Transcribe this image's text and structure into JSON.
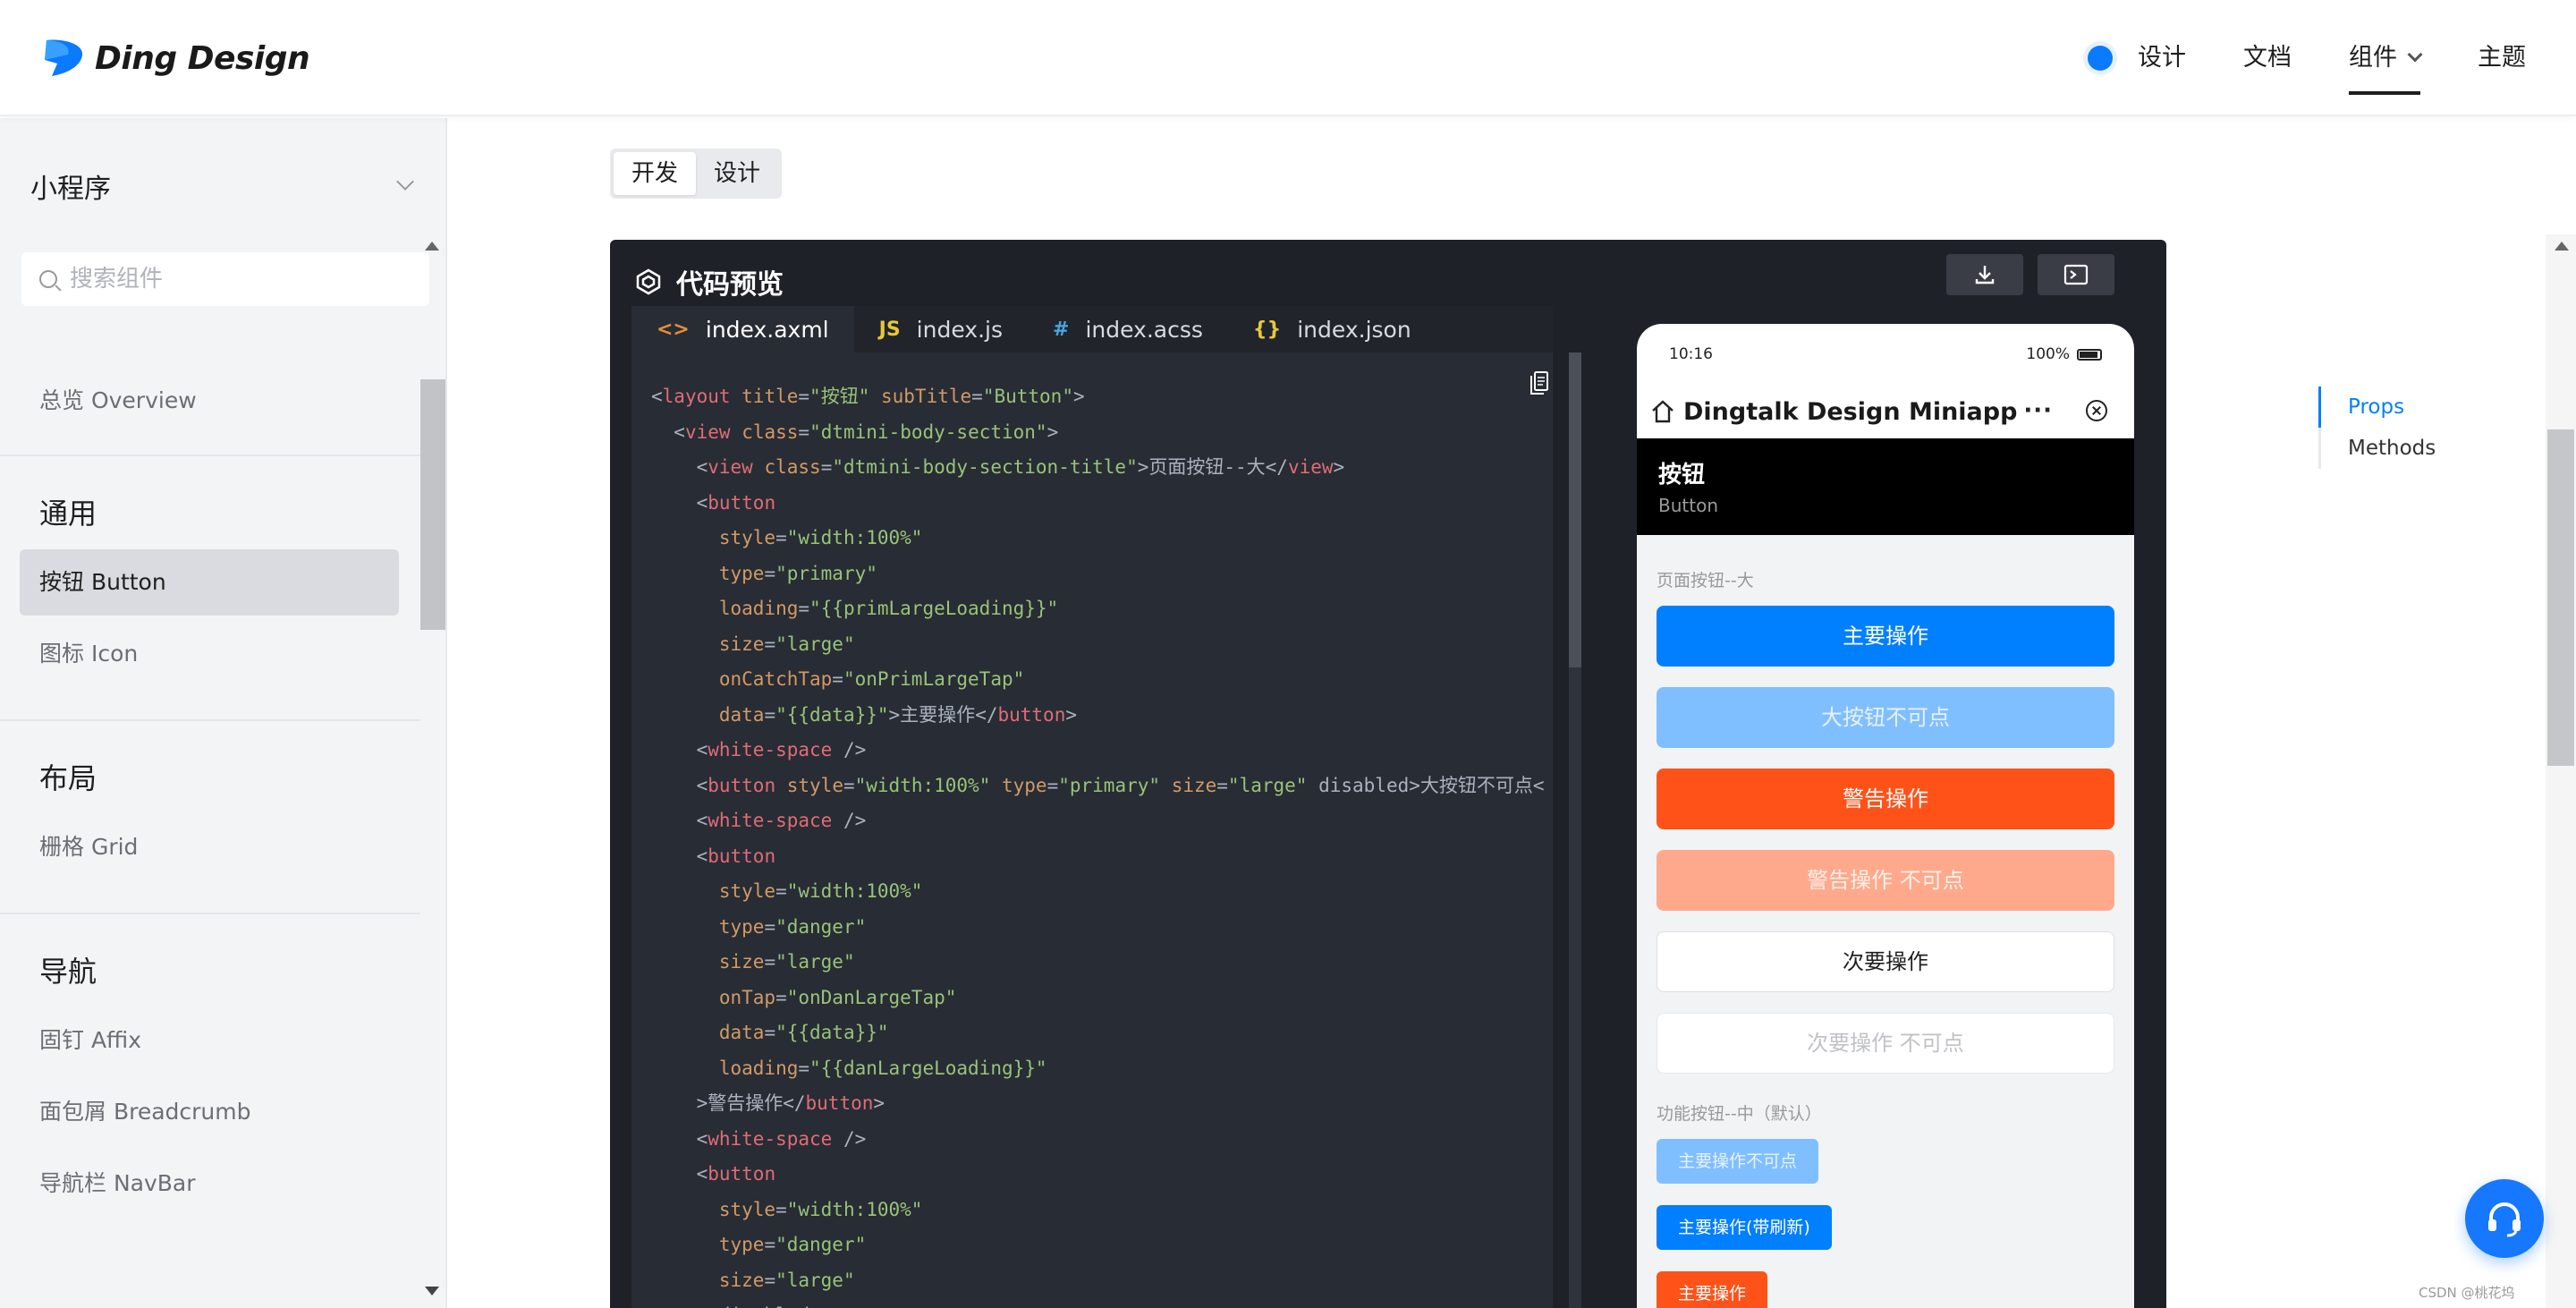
{
  "header": {
    "logo_text": "Ding Design",
    "nav": [
      "设计",
      "文档",
      "组件",
      "主题"
    ]
  },
  "sidebar": {
    "title": "小程序",
    "search_placeholder": "搜索组件",
    "overview": "总览 Overview",
    "groups": [
      {
        "title": "通用",
        "items": [
          "按钮 Button",
          "图标 Icon"
        ]
      },
      {
        "title": "布局",
        "items": [
          "栅格 Grid"
        ]
      },
      {
        "title": "导航",
        "items": [
          "固钉 Affix",
          "面包屑 Breadcrumb",
          "导航栏 NavBar"
        ]
      }
    ]
  },
  "segmented": {
    "dev": "开发",
    "design": "设计"
  },
  "panel": {
    "title": "代码预览",
    "tabs": [
      {
        "icon": "<>",
        "label": "index.axml"
      },
      {
        "icon": "JS",
        "label": "index.js"
      },
      {
        "icon": "#",
        "label": "index.acss"
      },
      {
        "icon": "{}",
        "label": "index.json"
      }
    ]
  },
  "phone": {
    "time": "10:16",
    "battery": "100%",
    "app_title": "Dingtalk Design Miniapp",
    "page_title": "按钮",
    "page_subtitle": "Button",
    "section1_label": "页面按钮--大",
    "large_buttons": [
      "主要操作",
      "大按钮不可点",
      "警告操作",
      "警告操作 不可点",
      "次要操作",
      "次要操作 不可点"
    ],
    "section2_label": "功能按钮--中（默认）",
    "small_buttons": [
      "主要操作不可点",
      "主要操作(带刷新)",
      "主要操作"
    ]
  },
  "toc": [
    "Props",
    "Methods"
  ],
  "watermark": "CSDN @桃花坞",
  "colors": {
    "primary": "#007fff",
    "danger": "#ff5219",
    "panel_bg": "#1f2128",
    "editor_bg": "#282c34"
  }
}
